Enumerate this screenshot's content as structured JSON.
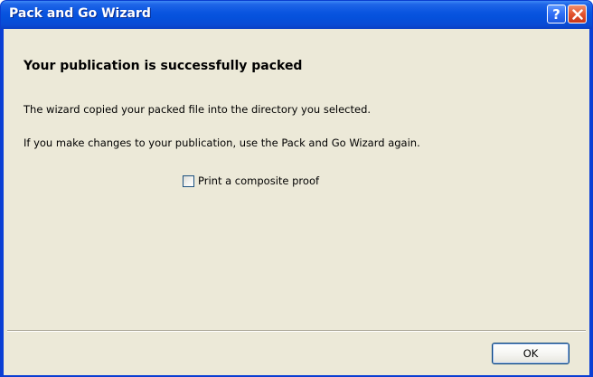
{
  "window": {
    "title": "Pack and Go Wizard",
    "help_glyph": "?",
    "help_icon": "help-icon",
    "close_icon": "close-icon"
  },
  "content": {
    "heading": "Your publication is successfully packed",
    "line1": "The wizard copied your packed file into the directory you selected.",
    "line2": "If you make changes to your publication, use the Pack and Go Wizard again."
  },
  "checkbox": {
    "label": "Print a composite proof",
    "checked": false
  },
  "buttons": {
    "ok_label": "OK"
  },
  "colors": {
    "titlebar": "#0a55e0",
    "client_bg": "#ece9d8",
    "close_button": "#e2532e",
    "help_button": "#2f6ef5"
  }
}
